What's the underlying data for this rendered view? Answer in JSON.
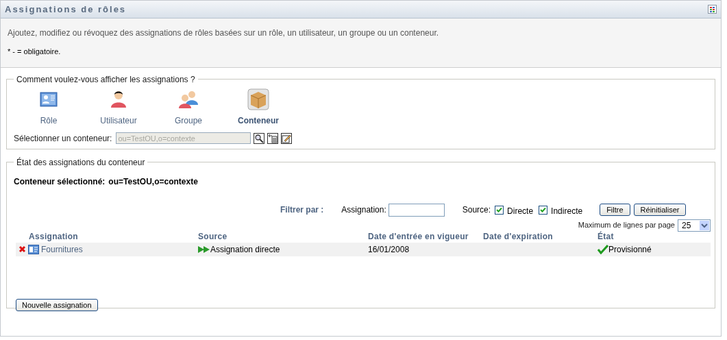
{
  "panel": {
    "title": "Assignations de rôles",
    "description": "Ajoutez, modifiez ou révoquez des assignations de rôles basées sur un rôle, un utilisateur, un groupe ou un conteneur.",
    "required_note": "* - = obligatoire."
  },
  "view_section": {
    "legend": "Comment voulez-vous afficher les assignations ?",
    "options": [
      {
        "kind": "role",
        "label": "Rôle",
        "selected": false
      },
      {
        "kind": "user",
        "label": "Utilisateur",
        "selected": false
      },
      {
        "kind": "group",
        "label": "Groupe",
        "selected": false
      },
      {
        "kind": "container",
        "label": "Conteneur",
        "selected": true
      }
    ],
    "container_label": "Sélectionner un conteneur:",
    "container_value": "ou=TestOU,o=contexte"
  },
  "status_section": {
    "legend": "État des assignations du conteneur",
    "selected_label": "Conteneur sélectionné:",
    "selected_value": "ou=TestOU,o=contexte",
    "filter": {
      "title": "Filtrer par :",
      "assignment_label": "Assignation:",
      "source_label": "Source:",
      "sources": [
        {
          "label": "Directe",
          "checked": true
        },
        {
          "label": "Indirecte",
          "checked": true
        }
      ],
      "buttons": [
        "Filtre",
        "Réinitialiser"
      ]
    },
    "page_size_label": "Maximum de lignes par page",
    "page_size": "25",
    "columns": [
      "Assignation",
      "Source",
      "Date d'entrée en vigueur",
      "Date d'expiration",
      "État"
    ],
    "rows": [
      {
        "assignment": "Fournitures",
        "source": "Assignation directe",
        "effective_date": "16/01/2008",
        "expiration_date": "",
        "state": "Provisionné"
      }
    ],
    "new_button": "Nouvelle assignation"
  }
}
